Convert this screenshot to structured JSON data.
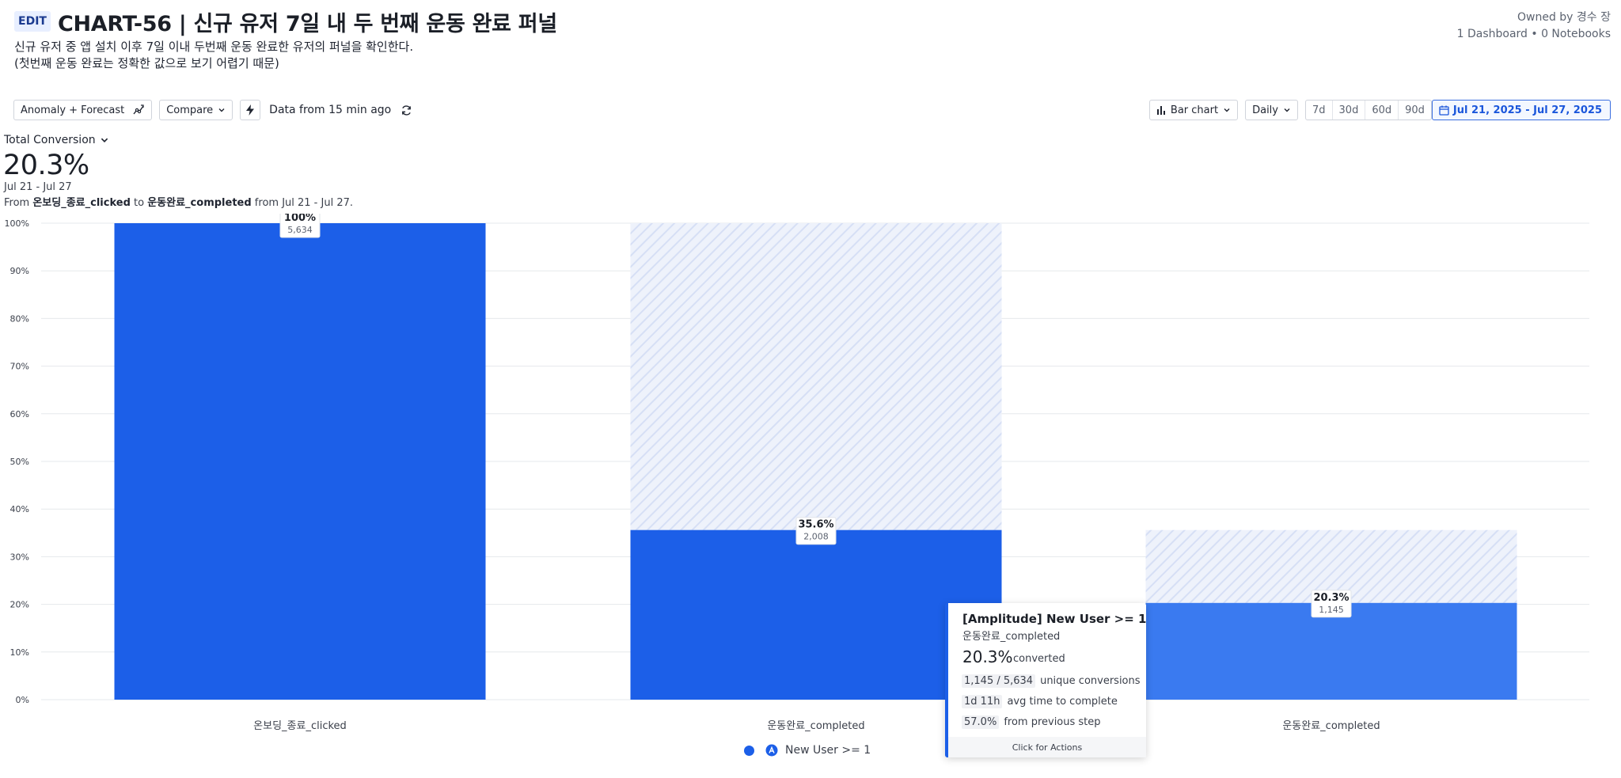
{
  "header": {
    "edit_label": "EDIT",
    "title": "CHART-56 | 신규 유저 7일 내 두 번째 운동 완료 퍼널",
    "description": "신규 유저 중 앱 설치 이후 7일 이내 두번째 운동 완료한 유저의 퍼널을 확인한다.\n(첫번째 운동 완료는 정확한 값으로 보기 어렵기 때문)",
    "owner": "Owned by 경수 장",
    "stats": "1 Dashboard • 0 Notebooks"
  },
  "toolbar": {
    "anomaly_label": "Anomaly + Forecast",
    "compare_label": "Compare",
    "data_from": "Data from 15 min ago",
    "chart_type_label": "Bar chart",
    "interval_label": "Daily",
    "ranges": [
      "7d",
      "30d",
      "60d",
      "90d"
    ],
    "date_range": "Jul 21, 2025 - Jul 27, 2025"
  },
  "summary": {
    "metric_label": "Total Conversion",
    "value": "20.3%",
    "range": "Jul 21 - Jul 27",
    "from_prefix": "From ",
    "from_event": "온보딩_종료_clicked",
    "to_word": " to ",
    "to_event": "운동완료_completed",
    "from_suffix": " from Jul 21 - Jul 27."
  },
  "colors": {
    "bar_primary": "#1c5fe8",
    "bar_last": "#3a7af0",
    "dropoff_hatch": "#dbe4f8"
  },
  "chart_data": {
    "type": "bar",
    "categories": [
      "온보딩_종료_clicked",
      "운동완료_completed",
      "운동완료_completed"
    ],
    "values": [
      100,
      35.6,
      20.3
    ],
    "dropoff_ceiling": [
      100,
      100,
      35.6
    ],
    "counts": [
      "5,634",
      "2,008",
      "1,145"
    ],
    "value_labels": [
      "100%",
      "35.6%",
      "20.3%"
    ],
    "y_ticks": [
      "0%",
      "10%",
      "20%",
      "30%",
      "40%",
      "50%",
      "60%",
      "70%",
      "80%",
      "90%",
      "100%"
    ],
    "ylim": [
      0,
      100
    ],
    "series": [
      {
        "name": "New User >= 1",
        "values": [
          100,
          35.6,
          20.3
        ]
      }
    ],
    "legend_position": "bottom",
    "grid": true
  },
  "legend": {
    "label": "New User >= 1"
  },
  "tooltip": {
    "title": "[Amplitude] New User >= 1",
    "step": "운동완료_completed",
    "percent": "20.3%",
    "percent_label": "converted",
    "rows": [
      {
        "value": "1,145 / 5,634",
        "label": "unique conversions"
      },
      {
        "value": "1d 11h",
        "label": "avg time to complete"
      },
      {
        "value": "57.0%",
        "label": "from previous step"
      }
    ],
    "footer": "Click for Actions"
  }
}
